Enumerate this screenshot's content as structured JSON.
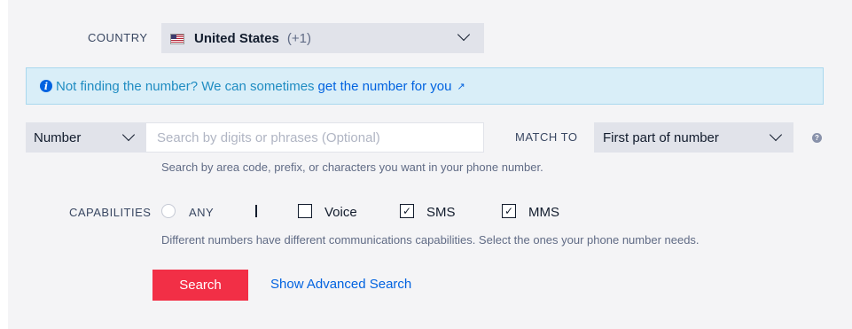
{
  "country": {
    "label": "COUNTRY",
    "name": "United States",
    "code": "(+1)",
    "flag_icon": "us-flag-icon"
  },
  "banner": {
    "text": "Not finding the number? We can sometimes",
    "link_text": "get the number for you",
    "link_icon": "external-link-icon",
    "link_glyph": "↗",
    "info_glyph": "i"
  },
  "search": {
    "type_value": "Number",
    "placeholder": "Search by digits or phrases (Optional)",
    "match_label": "MATCH TO",
    "match_value": "First part of number",
    "help_glyph": "?",
    "hint": "Search by area code, prefix, or characters you want in your phone number."
  },
  "capabilities": {
    "label": "CAPABILITIES",
    "any_label": "ANY",
    "options": [
      {
        "label": "Voice",
        "checked": false
      },
      {
        "label": "SMS",
        "checked": true
      },
      {
        "label": "MMS",
        "checked": true
      }
    ],
    "check_glyph": "✓",
    "hint": "Different numbers have different communications capabilities. Select the ones your phone number needs."
  },
  "actions": {
    "search_label": "Search",
    "advanced_label": "Show Advanced Search"
  },
  "colors": {
    "primary_button": "#f22f46",
    "link": "#0263e0",
    "banner_bg": "#d9eef8"
  }
}
